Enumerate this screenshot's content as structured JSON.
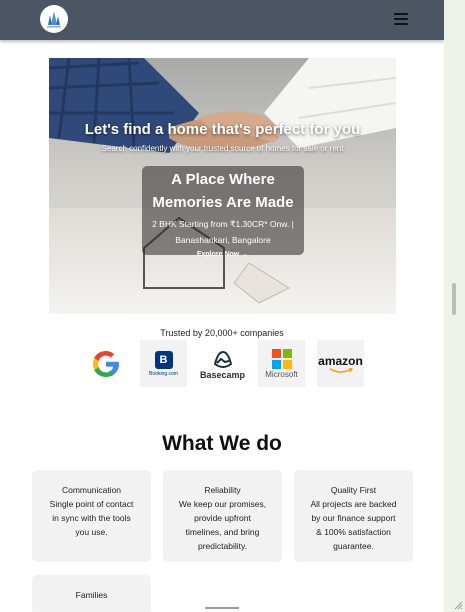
{
  "nav": {
    "logo": "company-logo-icon",
    "menu": "hamburger-menu-icon"
  },
  "hero": {
    "title": "Let's find a home that's perfect for you",
    "subtitle": "Search confidently with your trusted source of homes for sale or rent",
    "promo_title_line1": "A Place Where",
    "promo_title_line2": "Memories Are Made",
    "promo_desc_line1": "2 BHK Starting from ₹1.30CR* Onw. |",
    "promo_desc_line2": "Banashankari, Bangalore",
    "cta": "Explore Now →"
  },
  "trusted": {
    "label": "Trusted by 20,000+ companies",
    "logos": [
      "Google",
      "Booking.com",
      "Basecamp",
      "Microsoft",
      "amazon"
    ]
  },
  "section": {
    "title": "What We do",
    "cards": [
      {
        "title": "Communication",
        "desc": [
          "Single point of contact",
          "in sync with the tools",
          "you use."
        ]
      },
      {
        "title": "Reliability",
        "desc": [
          "We keep our promises,",
          "provide upfront",
          "timelines, and bring",
          "predictability."
        ]
      },
      {
        "title": "Quality First",
        "desc": [
          "All projects are backed",
          "by our finance support",
          "& 100% satisfaction",
          "guarantee."
        ]
      },
      {
        "title": "Families",
        "desc": []
      }
    ]
  },
  "colors": {
    "navbar": "#4b5563",
    "card_bg": "#f2f2f2",
    "page_bg": "#ffffff"
  }
}
